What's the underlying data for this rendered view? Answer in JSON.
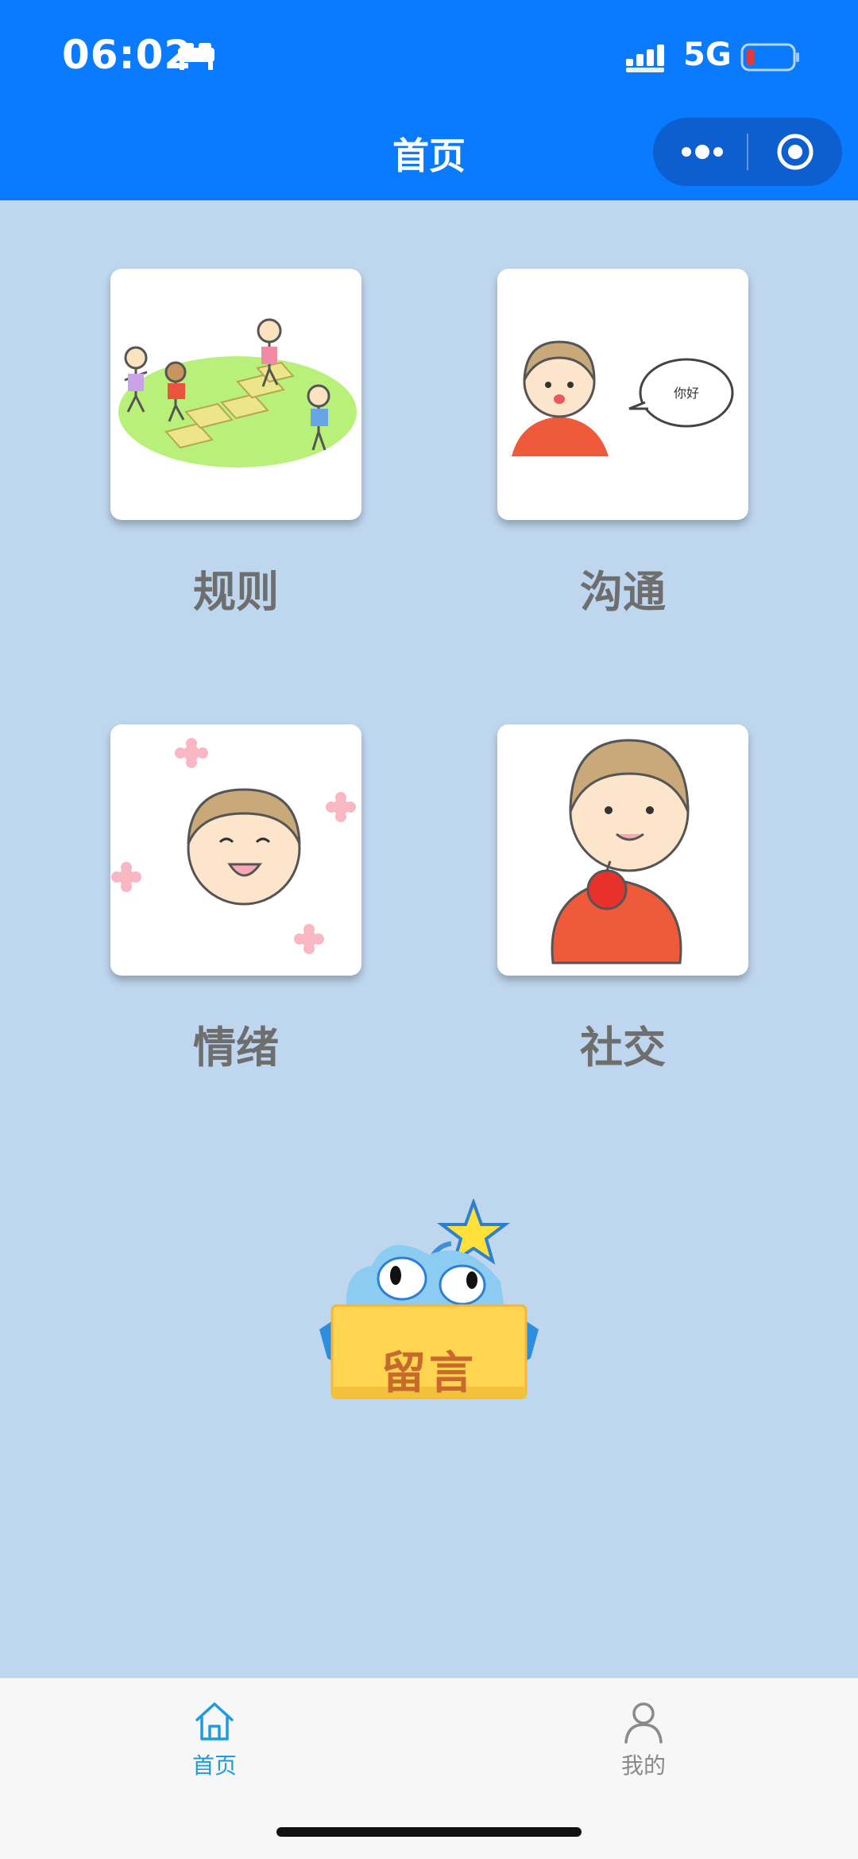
{
  "status_bar": {
    "time": "06:02",
    "network": "5G"
  },
  "nav": {
    "title": "首页"
  },
  "categories": [
    {
      "label": "规则",
      "bubble_text": ""
    },
    {
      "label": "沟通",
      "bubble_text": "你好"
    },
    {
      "label": "情绪",
      "bubble_text": ""
    },
    {
      "label": "社交",
      "bubble_text": ""
    }
  ],
  "message_button": {
    "label": "留言"
  },
  "tabs": [
    {
      "label": "首页",
      "icon": "home-icon",
      "active": true
    },
    {
      "label": "我的",
      "icon": "person-icon",
      "active": false
    }
  ],
  "colors": {
    "nav_bg": "#0A7BFF",
    "page_bg": "#BED6EE",
    "tab_active": "#1E9BE0",
    "tab_inactive": "#8A8A8A",
    "label_gray": "#6E6E6E"
  }
}
